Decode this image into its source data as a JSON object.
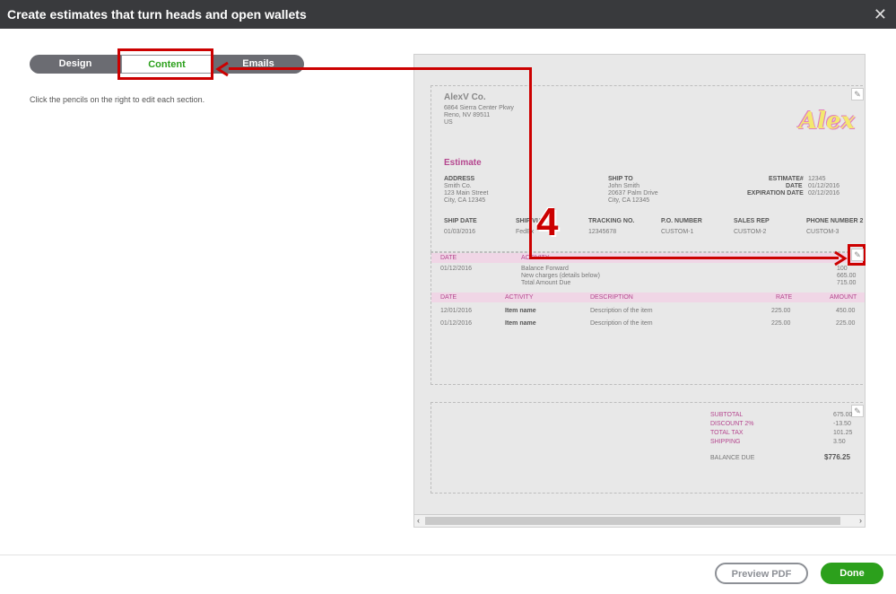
{
  "window": {
    "title": "Create estimates that turn heads and open wallets",
    "close_icon": "close-icon"
  },
  "tabs": [
    {
      "label": "Design"
    },
    {
      "label": "Content"
    },
    {
      "label": "Emails"
    }
  ],
  "hint": "Click the pencils on the right to edit each section.",
  "callout_number": "4",
  "preview": {
    "company": {
      "name": "AlexV Co.",
      "line1": "6864 Sierra Center Pkwy",
      "line2": "Reno, NV 89511",
      "line3": "US"
    },
    "logo_text": "Alex",
    "doc_title": "Estimate",
    "address": {
      "label": "ADDRESS",
      "l1": "Smith Co.",
      "l2": "123 Main Street",
      "l3": "City, CA 12345"
    },
    "ship_to": {
      "label": "SHIP TO",
      "l1": "John Smith",
      "l2": "20637 Palm Drive",
      "l3": "City, CA 12345"
    },
    "meta": {
      "estimate_label": "ESTIMATE#",
      "estimate_val": "12345",
      "date_label": "DATE",
      "date_val": "01/12/2016",
      "exp_label": "EXPIRATION DATE",
      "exp_val": "02/12/2016"
    },
    "ship_headers": [
      "SHIP DATE",
      "SHIP VIA",
      "TRACKING NO.",
      "P.O. NUMBER",
      "SALES REP",
      "PHONE NUMBER 2"
    ],
    "ship_values": [
      "01/03/2016",
      "FedEx",
      "12345678",
      "CUSTOM-1",
      "CUSTOM-2",
      "CUSTOM-3"
    ],
    "summary_headers": {
      "date": "DATE",
      "activity": "ACTIVITY"
    },
    "summary_date": "01/12/2016",
    "summary_lines": [
      "Balance Forward",
      "New charges (details below)",
      "Total Amount Due"
    ],
    "summary_amounts": [
      "100",
      "665.00",
      "715.00"
    ],
    "line_headers": [
      "DATE",
      "ACTIVITY",
      "DESCRIPTION",
      "RATE",
      "AMOUNT"
    ],
    "line_items": [
      {
        "date": "12/01/2016",
        "activity": "Item name",
        "desc": "Description of the item",
        "rate": "225.00",
        "amount": "450.00"
      },
      {
        "date": "01/12/2016",
        "activity": "Item name",
        "desc": "Description of the item",
        "rate": "225.00",
        "amount": "225.00"
      }
    ],
    "totals": [
      {
        "label": "SUBTOTAL",
        "value": "675.00"
      },
      {
        "label": "DISCOUNT 2%",
        "value": "-13.50"
      },
      {
        "label": "TOTAL TAX",
        "value": "101.25"
      },
      {
        "label": "SHIPPING",
        "value": "3.50"
      }
    ],
    "balance_label": "BALANCE DUE",
    "balance_value": "$776.25"
  },
  "footer": {
    "preview_pdf": "Preview PDF",
    "done": "Done"
  }
}
